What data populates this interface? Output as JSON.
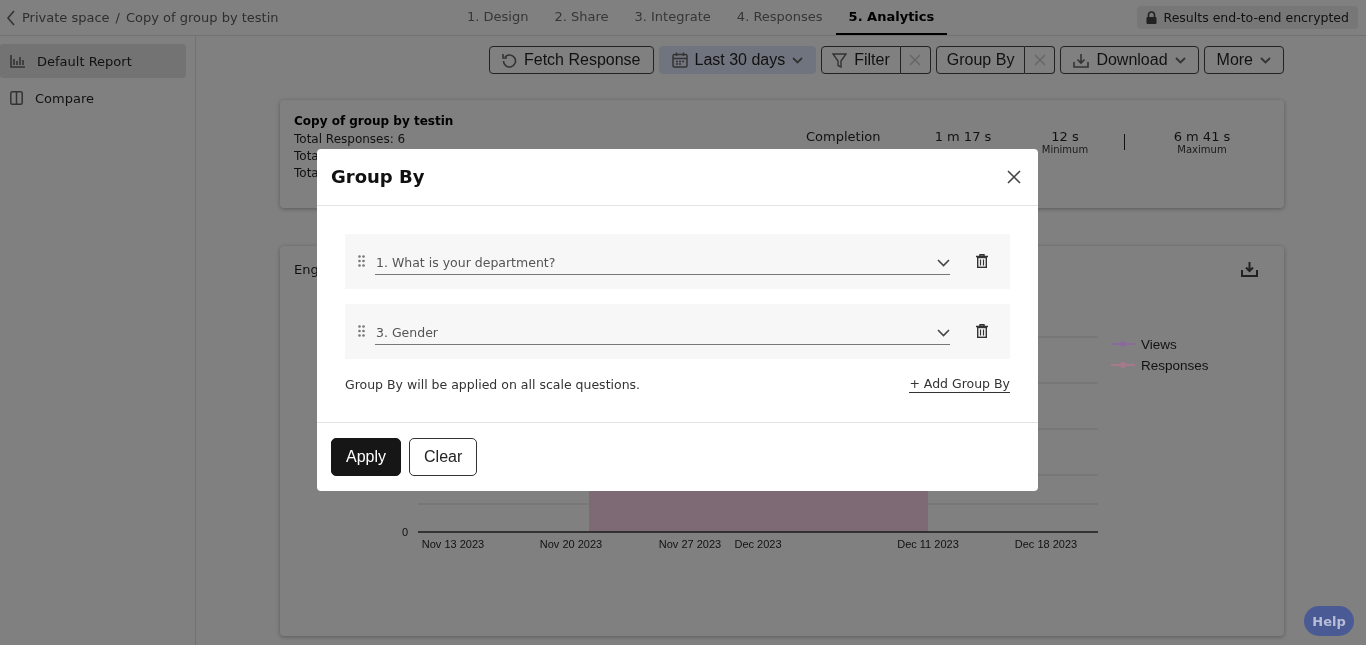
{
  "breadcrumb": {
    "space": "Private space",
    "separator": "/",
    "form": "Copy of group by testin"
  },
  "tabs": [
    {
      "label": "1. Design",
      "selected": false
    },
    {
      "label": "2. Share",
      "selected": false
    },
    {
      "label": "3. Integrate",
      "selected": false
    },
    {
      "label": "4. Responses",
      "selected": false
    },
    {
      "label": "5. Analytics",
      "selected": true
    }
  ],
  "encryption_badge": "Results end-to-end encrypted",
  "sidebar": {
    "items": [
      {
        "label": "Default Report",
        "selected": true
      },
      {
        "label": "Compare",
        "selected": false
      }
    ]
  },
  "toolbar": [
    {
      "kind": "plain",
      "label": "Fetch Response",
      "active": false
    },
    {
      "kind": "dropdown",
      "label": "Last 30 days",
      "active": true
    },
    {
      "kind": "split",
      "label": "Filter",
      "active": false
    },
    {
      "kind": "split",
      "label": "Group By",
      "active": false
    },
    {
      "kind": "dropdown",
      "label": "Download",
      "active": false
    },
    {
      "kind": "dropdown",
      "label": "More",
      "active": false
    }
  ],
  "summary": {
    "title": "Copy of group by testin",
    "lines": [
      "Total Responses: 6",
      "Tota",
      "Tota"
    ],
    "completion_label": "Completion",
    "stats": [
      {
        "value": "1 m 17 s"
      },
      {
        "value": "12 s",
        "label": "Minimum"
      },
      {
        "value": "6 m 41 s",
        "label": "Maximum"
      }
    ]
  },
  "chart": {
    "title": "Eng",
    "y_tick": "0",
    "x_labels": [
      "Nov 13 2023",
      "Nov 20 2023",
      "Nov 27 2023",
      "Dec 2023",
      "Dec 11 2023",
      "Dec 18 2023"
    ],
    "legend": [
      {
        "label": "Views",
        "color": "#8a6a9c"
      },
      {
        "label": "Responses",
        "color": "#a8788c"
      }
    ]
  },
  "help_button": "Help",
  "dialog": {
    "title": "Group By",
    "rows": [
      {
        "value": "1. What is your department?"
      },
      {
        "value": "3. Gender"
      }
    ],
    "note": "Group By will be applied on all scale questions.",
    "add_link": "+ Add Group By",
    "buttons": [
      {
        "label": "Apply",
        "kind": "primary"
      },
      {
        "label": "Clear",
        "kind": "secondary"
      }
    ]
  }
}
